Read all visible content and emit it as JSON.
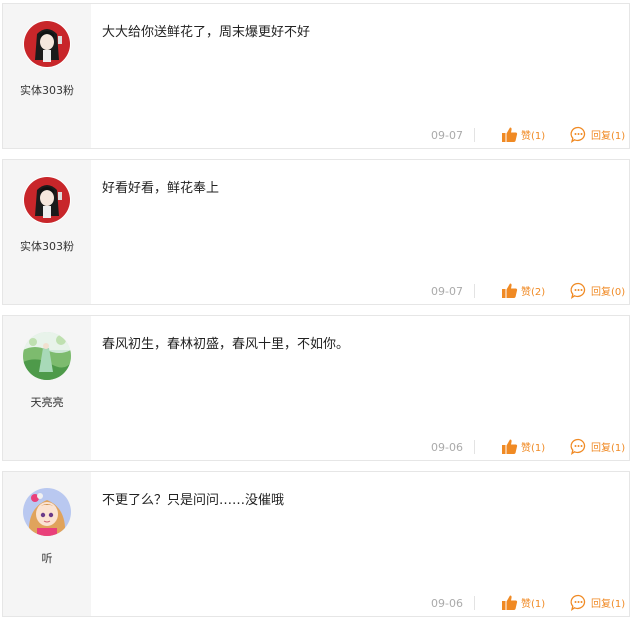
{
  "comments": [
    {
      "username": "实体303粉",
      "avatar_icon": "anime-girl-red-circle-avatar",
      "text": "大大给你送鲜花了，周末爆更好不好",
      "date": "09-07",
      "like_label": "赞(1)",
      "reply_label": "回复(1)"
    },
    {
      "username": "实体303粉",
      "avatar_icon": "anime-girl-red-circle-avatar",
      "text": "好看好看，鲜花奉上",
      "date": "09-07",
      "like_label": "赞(2)",
      "reply_label": "回复(0)"
    },
    {
      "username": "天亮亮",
      "avatar_icon": "garden-scene-avatar",
      "text": "春风初生，春林初盛，春风十里，不如你。",
      "date": "09-06",
      "like_label": "赞(1)",
      "reply_label": "回复(1)"
    },
    {
      "username": "听",
      "avatar_icon": "cartoon-girl-avatar",
      "text": "不更了么？只是问问……没催哦",
      "date": "09-06",
      "like_label": "赞(1)",
      "reply_label": "回复(1)"
    }
  ],
  "colors": {
    "accent": "#f08a24",
    "sidebar_bg": "#f5f5f5",
    "border": "#e6e6e6"
  }
}
